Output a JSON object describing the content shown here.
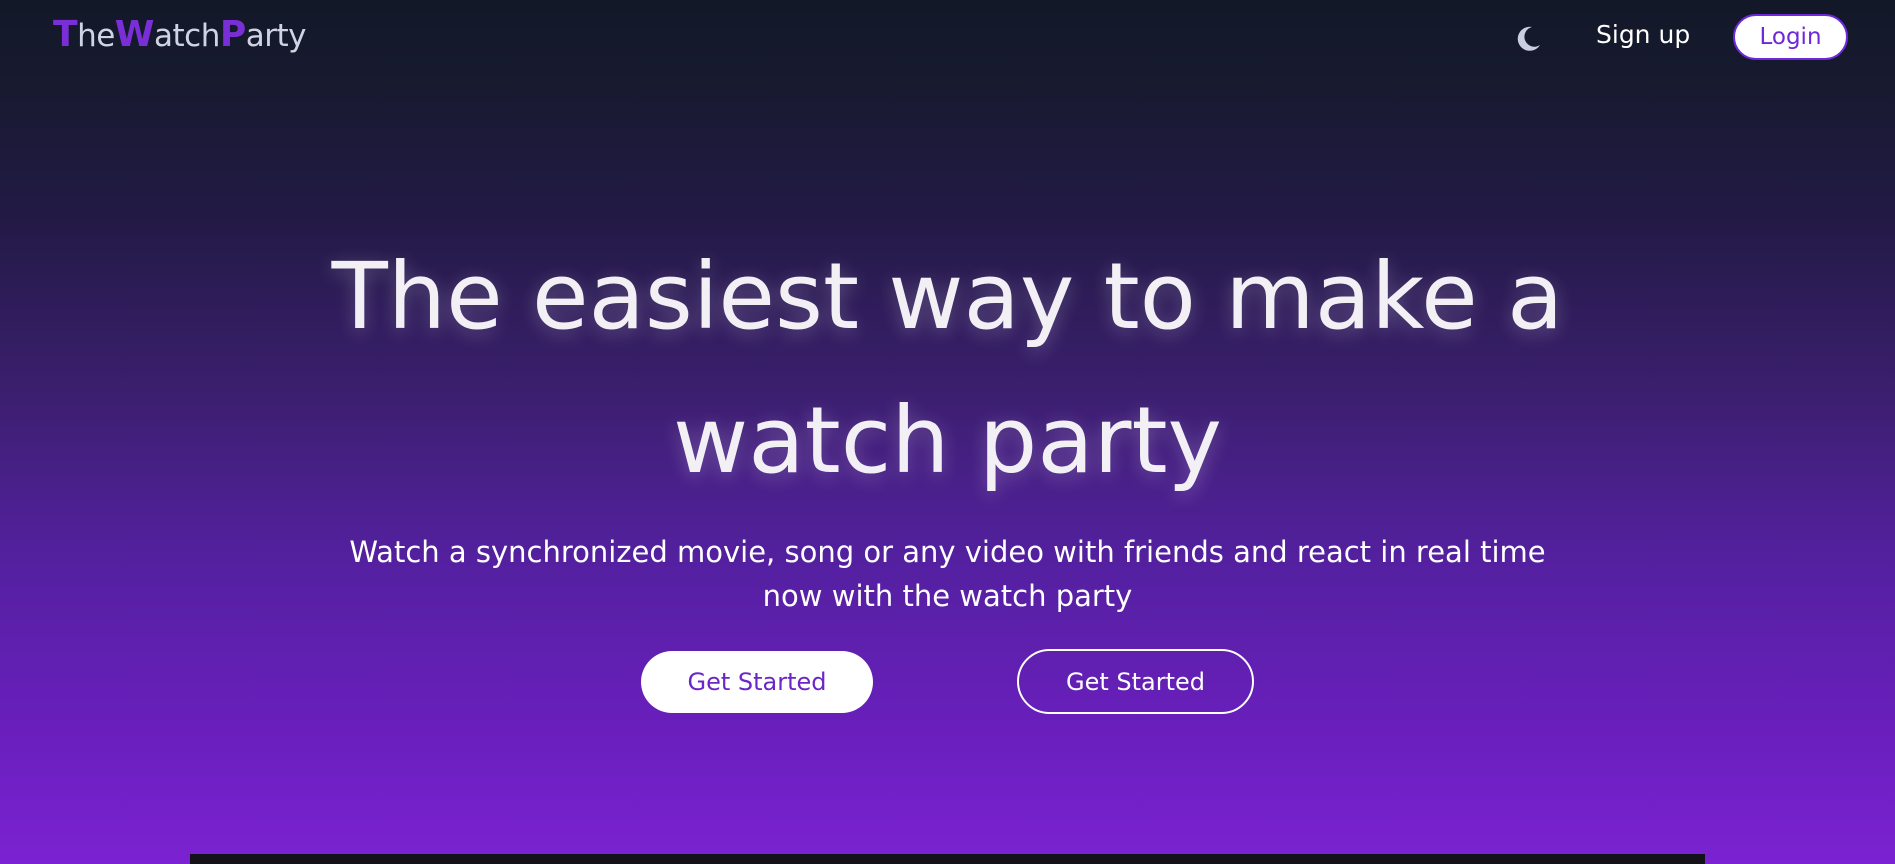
{
  "header": {
    "logo": {
      "parts": [
        {
          "text": "T",
          "style": "cap"
        },
        {
          "text": "he",
          "style": "low"
        },
        {
          "text": "W",
          "style": "cap"
        },
        {
          "text": "atch",
          "style": "low"
        },
        {
          "text": "P",
          "style": "cap"
        },
        {
          "text": "arty",
          "style": "low"
        }
      ]
    },
    "theme_toggle_icon": "moon-icon",
    "signup_label": "Sign up",
    "login_label": "Login"
  },
  "hero": {
    "title_line1": "The easiest way to make a",
    "title_line2": "watch party",
    "subtitle": "Watch a synchronized movie, song or any video with friends and react in real time now with the watch party",
    "primary_button_label": "Get Started",
    "secondary_button_label": "Get Started"
  },
  "colors": {
    "brand": "#7a2fd6",
    "accent": "#6d28d9",
    "background_top": "#121828",
    "background_bottom": "#7b22d2"
  }
}
